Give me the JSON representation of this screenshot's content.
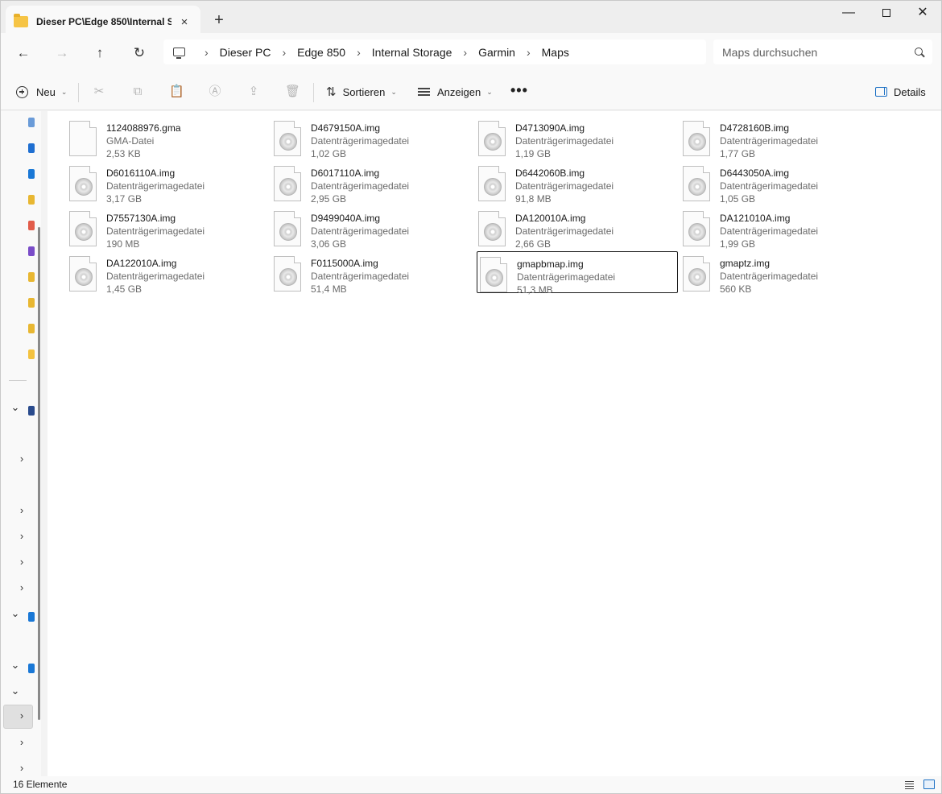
{
  "window": {
    "tab_title": "Dieser PC\\Edge 850\\Internal S",
    "close_tab_glyph": "×",
    "new_tab_glyph": "+",
    "minimize_glyph": "—",
    "close_glyph": "✕"
  },
  "nav": {
    "back_glyph": "←",
    "forward_glyph": "→",
    "up_glyph": "↑",
    "refresh_glyph": "↻",
    "breadcrumb": [
      "Dieser PC",
      "Edge 850",
      "Internal Storage",
      "Garmin",
      "Maps"
    ],
    "separator": "›",
    "search_placeholder": "Maps durchsuchen"
  },
  "toolbar": {
    "new_label": "Neu",
    "sort_label": "Sortieren",
    "view_label": "Anzeigen",
    "more_label": "•••",
    "details_label": "Details",
    "cut_glyph": "✂",
    "copy_glyph": "⧉",
    "paste_glyph": "📋",
    "rename_glyph": "Ⓐ",
    "share_glyph": "⇪",
    "delete_glyph": "🗑",
    "chevron_glyph": "⌄"
  },
  "sidebar": {
    "icon_colors": [
      "#6a9bd8",
      "#1f6fd1",
      "#1a78d6",
      "#e8b732",
      "#e25c4a",
      "#7a4cc8",
      "#e8b732",
      "#e8b732",
      "#e8b732",
      "#f3c240"
    ],
    "expand_glyph": "⌄",
    "collapse_glyph": "›"
  },
  "files": [
    {
      "name": "1124088976.gma",
      "type": "GMA-Datei",
      "size": "2,53 KB",
      "icon": "blank-file-icon"
    },
    {
      "name": "D4679150A.img",
      "type": "Datenträgerimagedatei",
      "size": "1,02 GB",
      "icon": "disc-image-icon"
    },
    {
      "name": "D4713090A.img",
      "type": "Datenträgerimagedatei",
      "size": "1,19 GB",
      "icon": "disc-image-icon"
    },
    {
      "name": "D4728160B.img",
      "type": "Datenträgerimagedatei",
      "size": "1,77 GB",
      "icon": "disc-image-icon"
    },
    {
      "name": "D6016110A.img",
      "type": "Datenträgerimagedatei",
      "size": "3,17 GB",
      "icon": "disc-image-icon"
    },
    {
      "name": "D6017110A.img",
      "type": "Datenträgerimagedatei",
      "size": "2,95 GB",
      "icon": "disc-image-icon"
    },
    {
      "name": "D6442060B.img",
      "type": "Datenträgerimagedatei",
      "size": "91,8 MB",
      "icon": "disc-image-icon"
    },
    {
      "name": "D6443050A.img",
      "type": "Datenträgerimagedatei",
      "size": "1,05 GB",
      "icon": "disc-image-icon"
    },
    {
      "name": "D7557130A.img",
      "type": "Datenträgerimagedatei",
      "size": "190 MB",
      "icon": "disc-image-icon"
    },
    {
      "name": "D9499040A.img",
      "type": "Datenträgerimagedatei",
      "size": "3,06 GB",
      "icon": "disc-image-icon"
    },
    {
      "name": "DA120010A.img",
      "type": "Datenträgerimagedatei",
      "size": "2,66 GB",
      "icon": "disc-image-icon"
    },
    {
      "name": "DA121010A.img",
      "type": "Datenträgerimagedatei",
      "size": "1,99 GB",
      "icon": "disc-image-icon"
    },
    {
      "name": "DA122010A.img",
      "type": "Datenträgerimagedatei",
      "size": "1,45 GB",
      "icon": "disc-image-icon"
    },
    {
      "name": "F0115000A.img",
      "type": "Datenträgerimagedatei",
      "size": "51,4 MB",
      "icon": "disc-image-icon"
    },
    {
      "name": "gmapbmap.img",
      "type": "Datenträgerimagedatei",
      "size": "51,3 MB",
      "icon": "disc-image-icon",
      "selected": true
    },
    {
      "name": "gmaptz.img",
      "type": "Datenträgerimagedatei",
      "size": "560 KB",
      "icon": "disc-image-icon"
    }
  ],
  "status": {
    "count": "16 Elemente"
  },
  "colors": {
    "accent": "#1a6fc4",
    "folder": "#f6c445"
  }
}
